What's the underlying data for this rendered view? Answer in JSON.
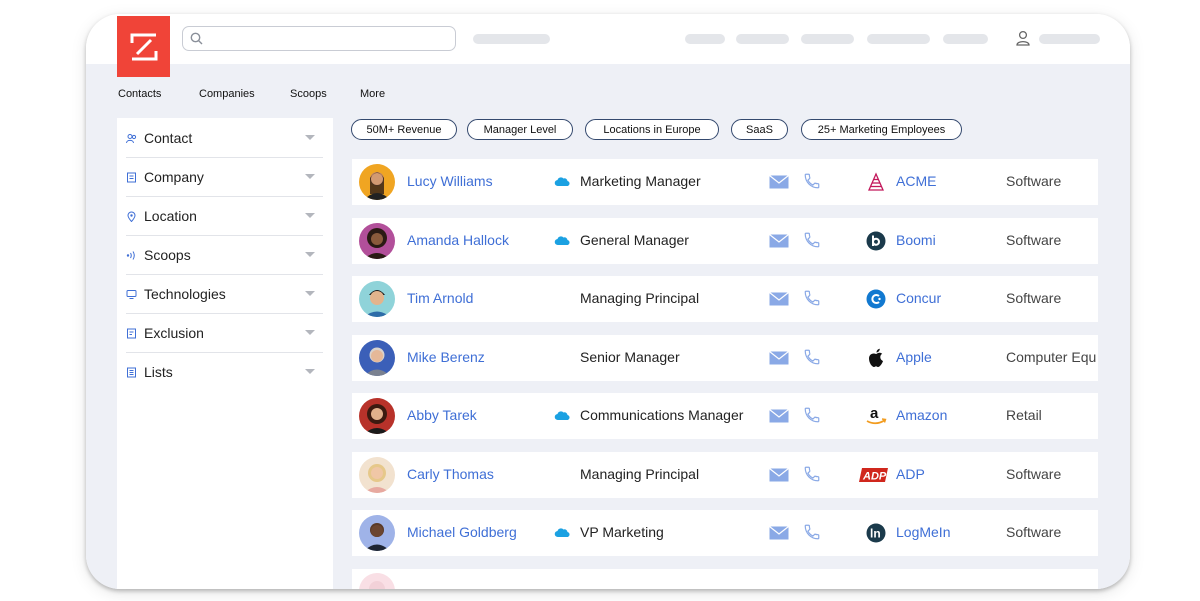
{
  "nav": [
    "Contacts",
    "Companies",
    "Scoops",
    "More"
  ],
  "sidebar": [
    {
      "label": "Contact",
      "icon": "contact-icon"
    },
    {
      "label": "Company",
      "icon": "company-icon"
    },
    {
      "label": "Location",
      "icon": "location-pin-icon"
    },
    {
      "label": "Scoops",
      "icon": "scoops-signal-icon"
    },
    {
      "label": "Technologies",
      "icon": "technologies-monitor-icon"
    },
    {
      "label": "Exclusion",
      "icon": "exclusion-list-icon"
    },
    {
      "label": "Lists",
      "icon": "lists-icon"
    }
  ],
  "filters": [
    "50M+ Revenue",
    "Manager Level",
    "Locations in Europe",
    "SaaS",
    "25+ Marketing Employees"
  ],
  "contacts": [
    {
      "name": "Lucy Williams",
      "title": "Marketing Manager",
      "company": "ACME",
      "industry": "Software",
      "salesforce": true
    },
    {
      "name": "Amanda Hallock",
      "title": "General Manager",
      "company": "Boomi",
      "industry": "Software",
      "salesforce": true
    },
    {
      "name": "Tim Arnold",
      "title": "Managing Principal",
      "company": "Concur",
      "industry": "Software",
      "salesforce": false
    },
    {
      "name": "Mike Berenz",
      "title": "Senior Manager",
      "company": "Apple",
      "industry": "Computer Equ",
      "salesforce": false
    },
    {
      "name": "Abby Tarek",
      "title": "Communications Manager",
      "company": "Amazon",
      "industry": "Retail",
      "salesforce": true
    },
    {
      "name": "Carly Thomas",
      "title": "Managing Principal",
      "company": "ADP",
      "industry": "Software",
      "salesforce": false
    },
    {
      "name": "Michael Goldberg",
      "title": "VP Marketing",
      "company": "LogMeIn",
      "industry": "Software",
      "salesforce": true
    }
  ],
  "colors": {
    "brand": "#f04438",
    "link": "#3f6fd6",
    "chip_border": "#34496e",
    "salesforce": "#1ba1e2",
    "icon_blue": "#8aa9e6"
  }
}
